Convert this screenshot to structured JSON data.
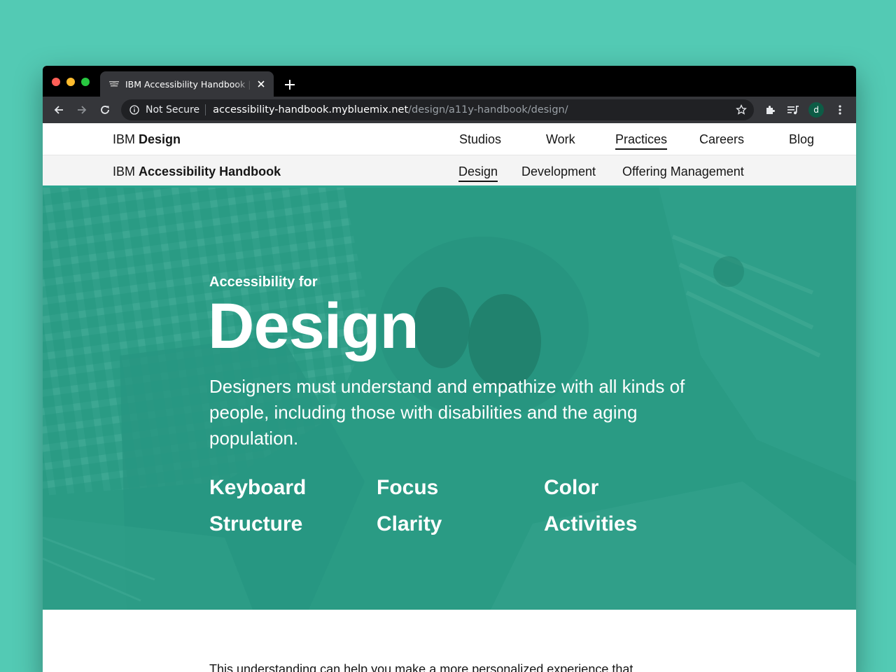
{
  "browser": {
    "tab_title": "IBM Accessibility Handbook | Design",
    "security_label": "Not Secure",
    "url_host": "accessibility-handbook.mybluemix.net",
    "url_path": "/design/a11y-handbook/design/",
    "profile_initial": "d"
  },
  "site_nav": {
    "brand_prefix": "IBM",
    "brand_bold": "Design",
    "links": [
      "Studios",
      "Work",
      "Practices",
      "Careers",
      "Blog"
    ],
    "active": "Practices"
  },
  "sub_nav": {
    "brand_prefix": "IBM",
    "brand_bold": "Accessibility Handbook",
    "links": [
      "Design",
      "Development",
      "Offering Management"
    ],
    "active": "Design"
  },
  "hero": {
    "kicker": "Accessibility for",
    "title": "Design",
    "description": "Designers must understand and empathize with all kinds of people, including those with disabilities and the aging population.",
    "topics": [
      "Keyboard",
      "Focus",
      "Color",
      "Structure",
      "Clarity",
      "Activities"
    ]
  },
  "body": {
    "intro": "This understanding can help you make a more personalized experience that"
  },
  "colors": {
    "desktop_bg": "#53cab4",
    "hero_teal": "#2a9b85",
    "accent": "#2aa58f"
  }
}
